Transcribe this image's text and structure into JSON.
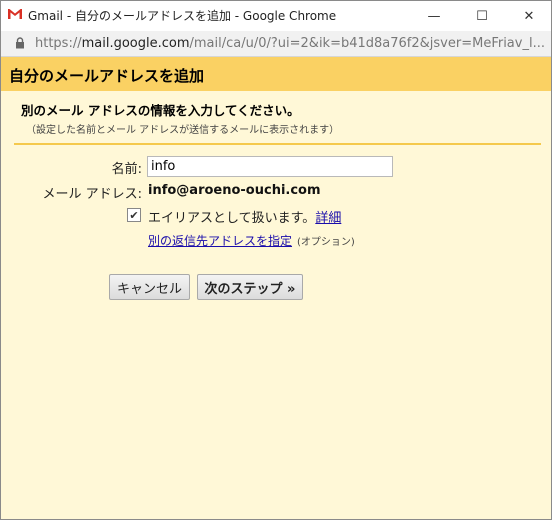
{
  "window": {
    "title": "Gmail - 自分のメールアドレスを追加 - Google Chrome",
    "minimize_glyph": "—",
    "maximize_glyph": "☐",
    "close_glyph": "✕"
  },
  "address_bar": {
    "url_scheme": "https://",
    "url_host": "mail.google.com",
    "url_rest": "/mail/ca/u/0/?ui=2&ik=b41d8a76f2&jsver=MeFriav_l..."
  },
  "dialog": {
    "title": "自分のメールアドレスを追加",
    "section_title": "別のメール アドレスの情報を入力してください。",
    "section_subtitle": "（設定した名前とメール アドレスが送信するメールに表示されます）",
    "name_label": "名前:",
    "name_value": "info",
    "email_label": "メール アドレス:",
    "email_value": "info@aroeno-ouchi.com",
    "alias_checked": true,
    "alias_label": "エイリアスとして扱います。",
    "alias_details_link": "詳細",
    "reply_to_link": "別の返信先アドレスを指定",
    "reply_to_optional": "(オプション)",
    "cancel_button": "キャンセル",
    "next_button": "次のステップ »"
  },
  "colors": {
    "header_bg": "#fad163",
    "dialog_bg": "#fff8d7",
    "divider": "#f5c94c",
    "link": "#1a0dab"
  },
  "icons": {
    "app": "gmail-icon",
    "secure": "lock-icon",
    "checkbox": "checkmark-icon"
  }
}
